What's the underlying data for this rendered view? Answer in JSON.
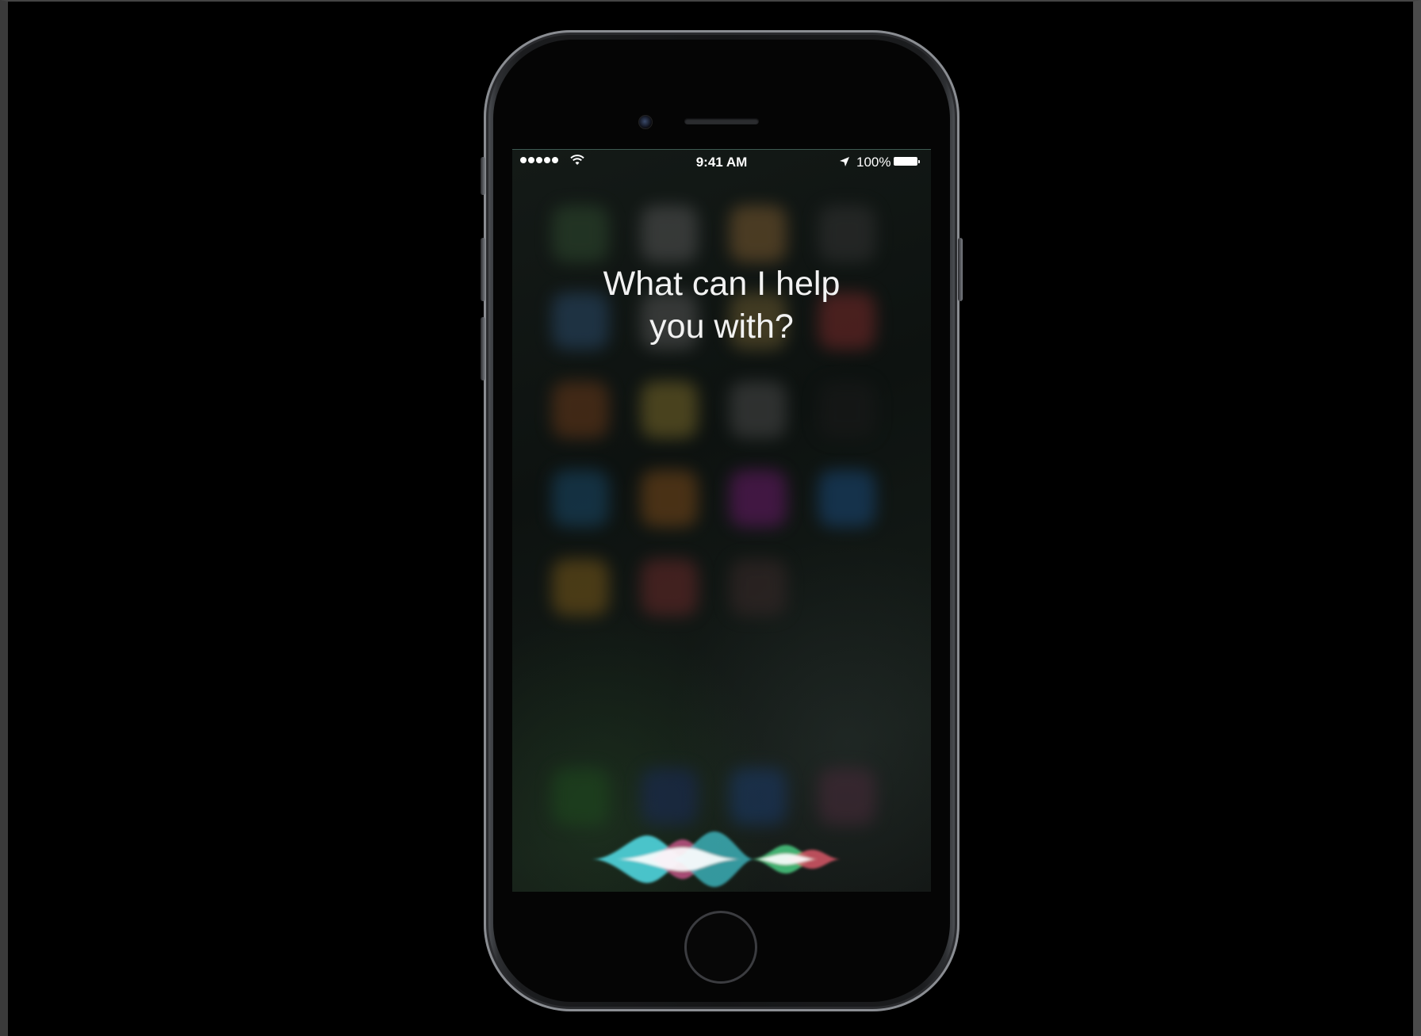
{
  "status_bar": {
    "signal_dots": 5,
    "wifi_icon": "wifi-icon",
    "time": "9:41 AM",
    "location_icon": "location-arrow-icon",
    "battery_percent": "100%",
    "battery_icon": "battery-icon",
    "battery_level": 1.0
  },
  "siri": {
    "prompt_line1": "What can I help",
    "prompt_line2": "you with?",
    "waveform_icon": "siri-waveform",
    "colors": {
      "cyan": "#3fd9e6",
      "magenta": "#e0438f",
      "green": "#3bd17a",
      "white": "#ffffff"
    }
  },
  "device": {
    "home_button_icon": "home-button",
    "camera_icon": "front-camera-icon",
    "speaker_icon": "earpiece-speaker"
  }
}
